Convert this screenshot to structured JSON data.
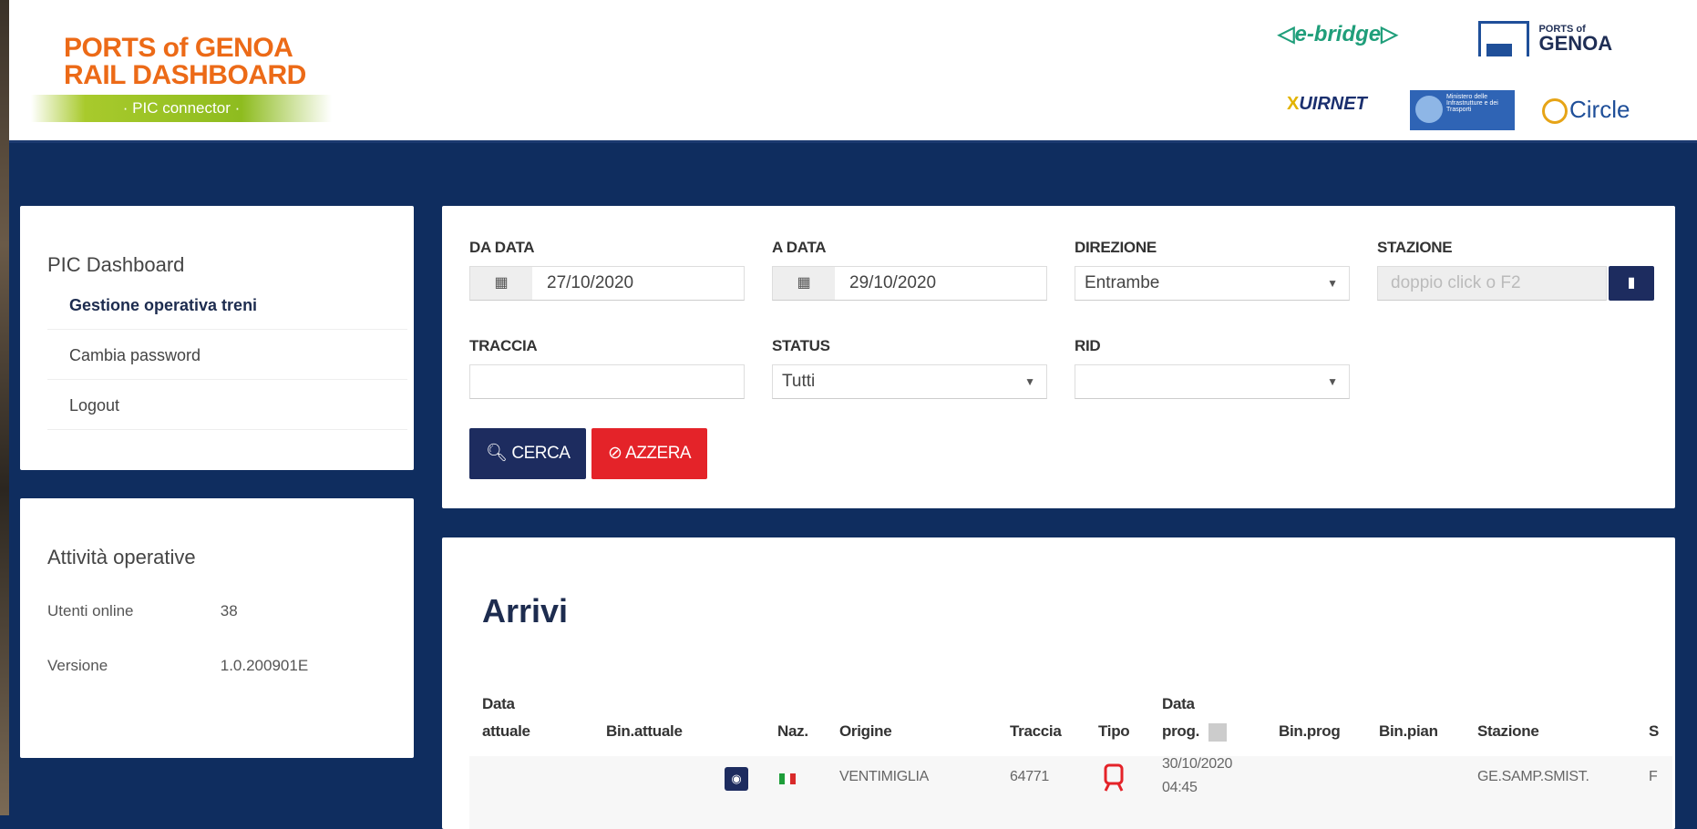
{
  "header": {
    "title_line1": "PORTS of GENOA",
    "title_line2": "RAIL DASHBOARD",
    "subtitle": "· PIC connector ·",
    "logos": {
      "ebridge": "e-bridge",
      "genoa_small": "PORTS of",
      "genoa_big": "GENOA",
      "uirnet": "UIRNET",
      "mit": "Ministero delle Infrastrutture e dei Trasporti",
      "circle": "Circle"
    }
  },
  "sidebar": {
    "title": "PIC Dashboard",
    "items": [
      {
        "label": "Gestione operativa treni",
        "active": true
      },
      {
        "label": "Cambia password",
        "active": false
      },
      {
        "label": "Logout",
        "active": false
      }
    ]
  },
  "info": {
    "title": "Attività operative",
    "rows": [
      {
        "label": "Utenti online",
        "value": "38"
      },
      {
        "label": "Versione",
        "value": "1.0.200901E"
      }
    ]
  },
  "search": {
    "da_data": {
      "label": "DA DATA",
      "value": "27/10/2020"
    },
    "a_data": {
      "label": "A DATA",
      "value": "29/10/2020"
    },
    "direzione": {
      "label": "DIREZIONE",
      "value": "Entrambe"
    },
    "stazione": {
      "label": "STAZIONE",
      "placeholder": "doppio click o F2"
    },
    "traccia": {
      "label": "TRACCIA",
      "value": ""
    },
    "status": {
      "label": "STATUS",
      "value": "Tutti"
    },
    "rid": {
      "label": "RID",
      "value": ""
    },
    "cerca_label": "CERCA",
    "azzera_label": "AZZERA"
  },
  "results": {
    "title": "Arrivi",
    "columns": {
      "data_attuale_1": "Data",
      "data_attuale_2": "attuale",
      "bin_attuale": "Bin.attuale",
      "naz": "Naz.",
      "origine": "Origine",
      "traccia": "Traccia",
      "tipo": "Tipo",
      "data_prog_1": "Data",
      "data_prog_2": "prog.",
      "bin_prog": "Bin.prog",
      "bin_pian": "Bin.pian",
      "stazione": "Stazione",
      "cut": "S"
    },
    "rows": [
      {
        "data_attuale": "",
        "bin_attuale": "",
        "origine": "VENTIMIGLIA",
        "traccia": "64771",
        "data_prog_1": "30/10/2020",
        "data_prog_2": "04:45",
        "bin_prog": "",
        "bin_pian": "",
        "stazione": "GE.SAMP.SMIST.",
        "cut": "F"
      }
    ]
  },
  "colors": {
    "navy": "#1d2c5f",
    "background": "#0f2d5f",
    "orange": "#ec6a17",
    "green": "#8ebc1f",
    "red": "#e42329"
  }
}
